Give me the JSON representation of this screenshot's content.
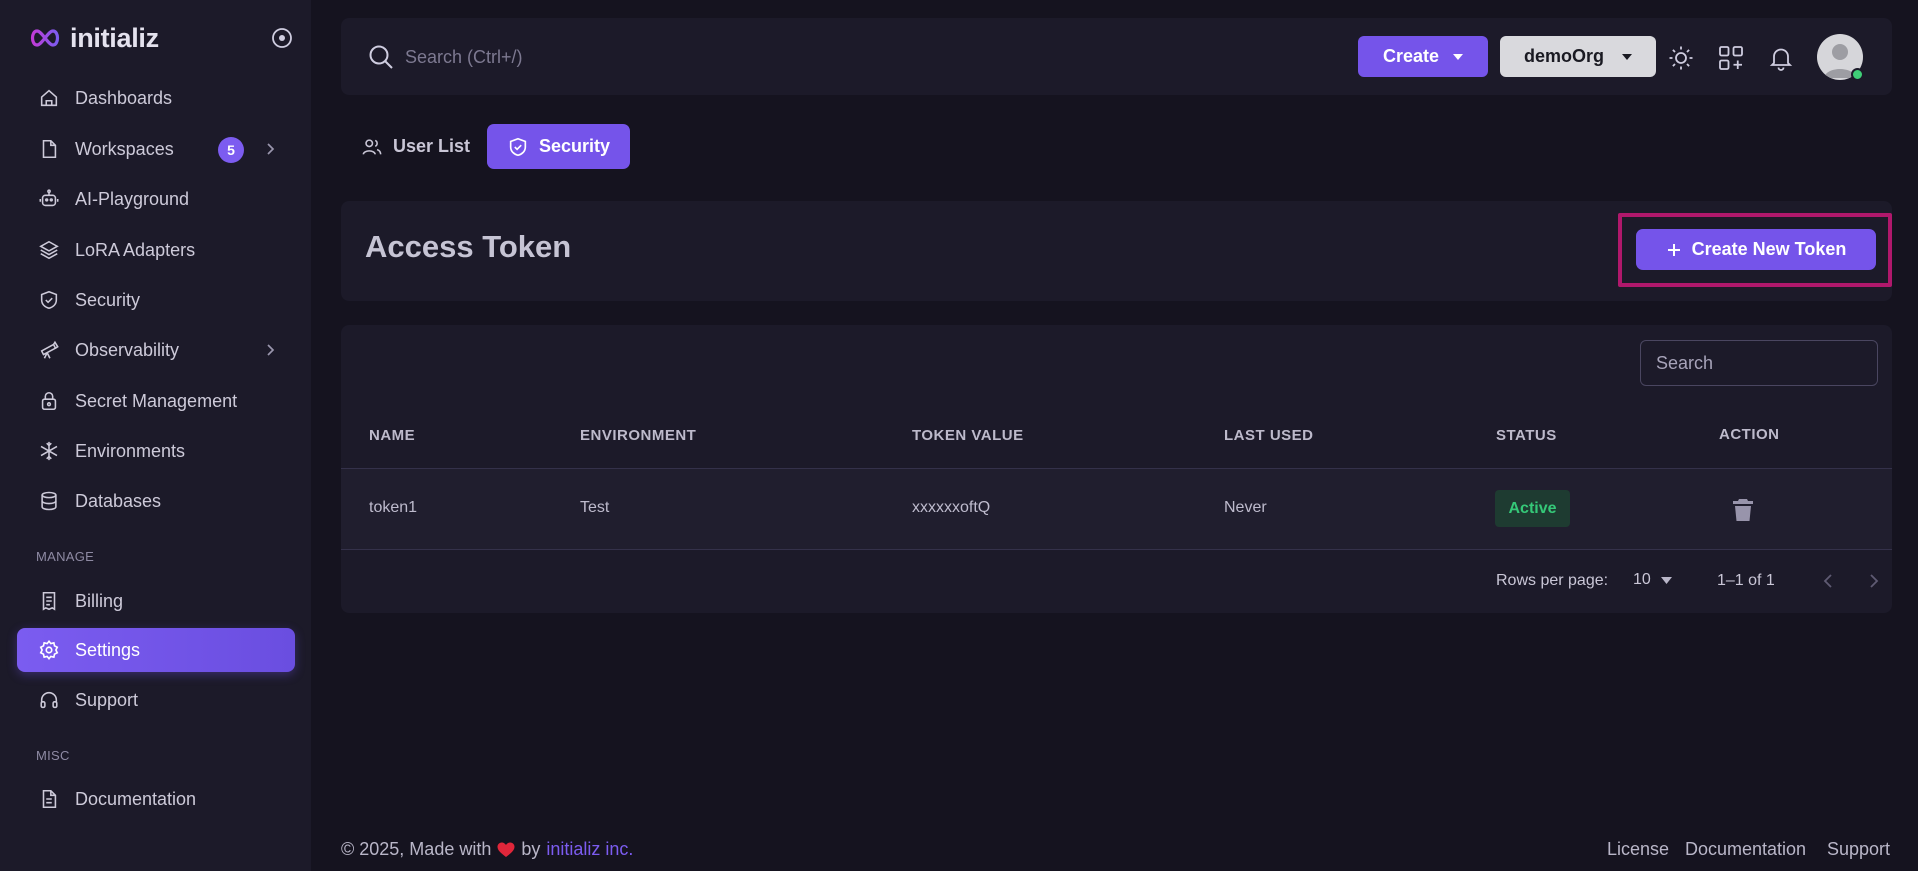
{
  "brand": {
    "name": "initializ"
  },
  "sidebar": {
    "items": [
      {
        "label": "Dashboards",
        "icon": "home-icon"
      },
      {
        "label": "Workspaces",
        "icon": "file-icon",
        "badge": "5"
      },
      {
        "label": "AI-Playground",
        "icon": "robot-icon"
      },
      {
        "label": "LoRA Adapters",
        "icon": "layers-icon"
      },
      {
        "label": "Security",
        "icon": "shield-icon"
      },
      {
        "label": "Observability",
        "icon": "telescope-icon"
      },
      {
        "label": "Secret Management",
        "icon": "lock-icon"
      },
      {
        "label": "Environments",
        "icon": "snowflake-icon"
      },
      {
        "label": "Databases",
        "icon": "database-icon"
      }
    ],
    "manage_label": "MANAGE",
    "manage_items": [
      {
        "label": "Billing",
        "icon": "receipt-icon"
      },
      {
        "label": "Settings",
        "icon": "gear-icon",
        "active": true
      },
      {
        "label": "Support",
        "icon": "headphones-icon"
      }
    ],
    "misc_label": "MISC",
    "misc_items": [
      {
        "label": "Documentation",
        "icon": "document-icon"
      }
    ]
  },
  "topbar": {
    "search_placeholder": "Search (Ctrl+/)",
    "create_label": "Create",
    "org_label": "demoOrg"
  },
  "tabs": [
    {
      "label": "User List",
      "icon": "users-icon"
    },
    {
      "label": "Security",
      "icon": "shield-check-icon",
      "active": true
    }
  ],
  "page": {
    "title": "Access Token",
    "create_token_label": "Create New Token"
  },
  "table": {
    "search_placeholder": "Search",
    "columns": [
      "NAME",
      "ENVIRONMENT",
      "TOKEN VALUE",
      "LAST USED",
      "STATUS",
      "ACTION"
    ],
    "rows": [
      {
        "name": "token1",
        "environment": "Test",
        "token_value": "xxxxxxoftQ",
        "last_used": "Never",
        "status": "Active"
      }
    ],
    "rows_per_page_label": "Rows per page:",
    "rows_per_page": "10",
    "range": "1–1 of 1"
  },
  "footer": {
    "copyright": "© 2025, Made with",
    "by": "by",
    "company": "initializ inc.",
    "links": [
      "License",
      "Documentation",
      "Support"
    ]
  },
  "colors": {
    "accent": "#7554ea",
    "background": "#15131f",
    "surface": "#1c1a29",
    "highlight": "#b0186c",
    "success": "#35c878"
  }
}
